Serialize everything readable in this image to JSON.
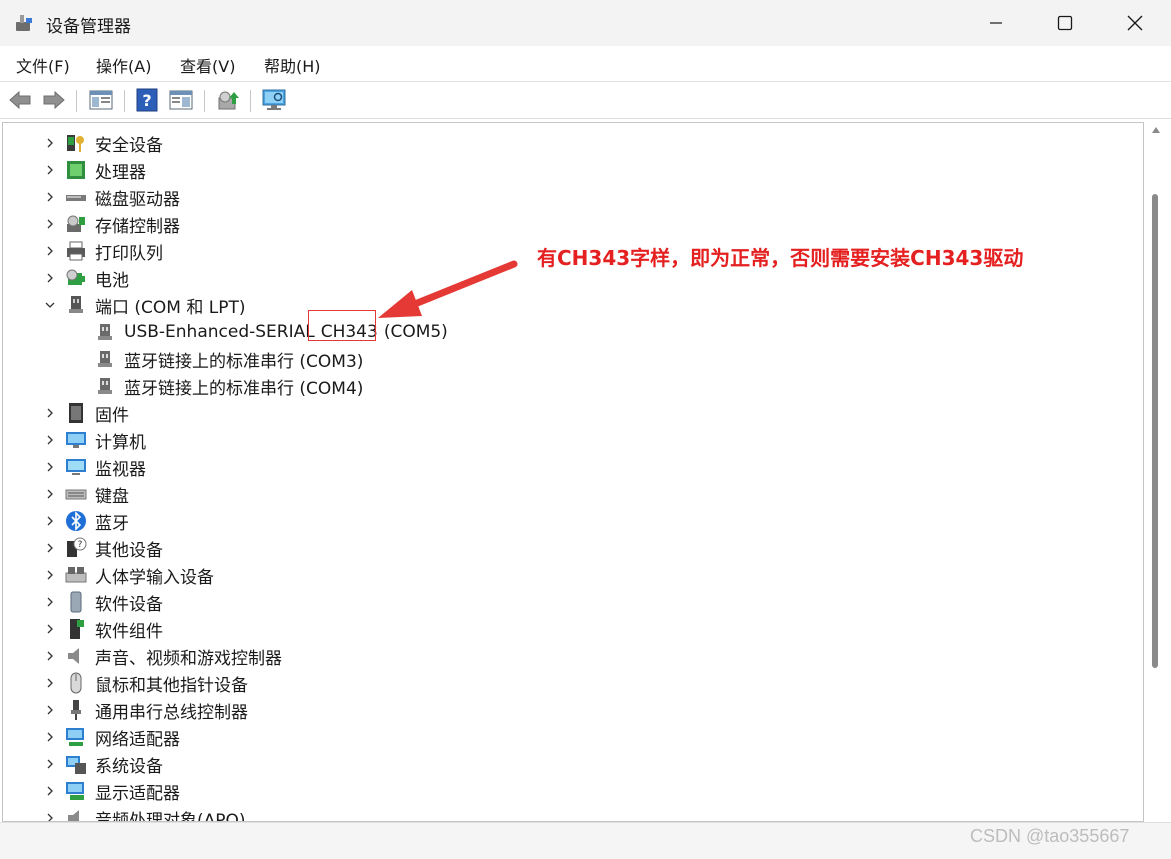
{
  "window": {
    "title": "设备管理器"
  },
  "menu": [
    "文件(F)",
    "操作(A)",
    "查看(V)",
    "帮助(H)"
  ],
  "tree": [
    {
      "label": "安全设备",
      "icon": "security-key-icon",
      "expanded": false
    },
    {
      "label": "处理器",
      "icon": "processor-icon",
      "expanded": false
    },
    {
      "label": "磁盘驱动器",
      "icon": "disk-drive-icon",
      "expanded": false
    },
    {
      "label": "存储控制器",
      "icon": "storage-controller-icon",
      "expanded": false
    },
    {
      "label": "打印队列",
      "icon": "printer-icon",
      "expanded": false
    },
    {
      "label": "电池",
      "icon": "battery-icon",
      "expanded": false
    },
    {
      "label": "端口 (COM 和 LPT)",
      "icon": "port-icon",
      "expanded": true,
      "children": [
        {
          "prefix": "USB-Enhanced-SERIAL",
          "highlight": "CH343",
          "suffix": "(COM5)"
        },
        {
          "prefix": "蓝牙链接上的标准串行 (COM3)",
          "highlight": "",
          "suffix": ""
        },
        {
          "prefix": "蓝牙链接上的标准串行 (COM4)",
          "highlight": "",
          "suffix": ""
        }
      ]
    },
    {
      "label": "固件",
      "icon": "firmware-icon",
      "expanded": false
    },
    {
      "label": "计算机",
      "icon": "computer-icon",
      "expanded": false
    },
    {
      "label": "监视器",
      "icon": "monitor-icon",
      "expanded": false
    },
    {
      "label": "键盘",
      "icon": "keyboard-icon",
      "expanded": false
    },
    {
      "label": "蓝牙",
      "icon": "bluetooth-icon",
      "expanded": false
    },
    {
      "label": "其他设备",
      "icon": "other-device-icon",
      "expanded": false
    },
    {
      "label": "人体学输入设备",
      "icon": "hid-icon",
      "expanded": false
    },
    {
      "label": "软件设备",
      "icon": "software-device-icon",
      "expanded": false
    },
    {
      "label": "软件组件",
      "icon": "software-component-icon",
      "expanded": false
    },
    {
      "label": "声音、视频和游戏控制器",
      "icon": "speaker-icon",
      "expanded": false
    },
    {
      "label": "鼠标和其他指针设备",
      "icon": "mouse-icon",
      "expanded": false
    },
    {
      "label": "通用串行总线控制器",
      "icon": "usb-icon",
      "expanded": false
    },
    {
      "label": "网络适配器",
      "icon": "network-adapter-icon",
      "expanded": false
    },
    {
      "label": "系统设备",
      "icon": "system-device-icon",
      "expanded": false
    },
    {
      "label": "显示适配器",
      "icon": "display-adapter-icon",
      "expanded": false
    },
    {
      "label": "音频处理对象(APO)",
      "icon": "apo-icon",
      "expanded": false
    }
  ],
  "annotation": {
    "text": "有CH343字样，即为正常，否则需要安装CH343驱动",
    "color": "#e52020"
  },
  "watermark": "CSDN @tao355667"
}
